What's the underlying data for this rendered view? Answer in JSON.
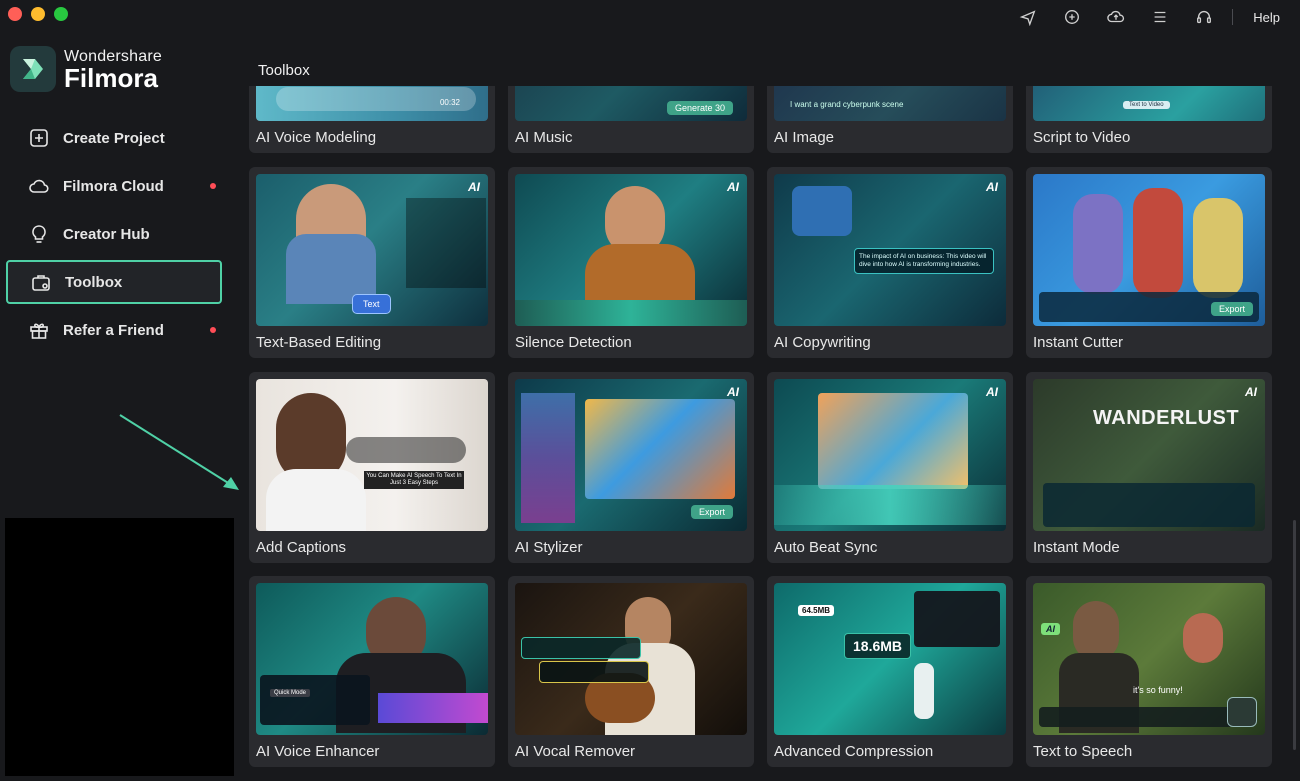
{
  "window": {
    "help_label": "Help"
  },
  "brand": {
    "line1": "Wondershare",
    "line2": "Filmora"
  },
  "nav": {
    "items": [
      {
        "label": "Create Project",
        "icon": "plus-square-icon",
        "dot": false,
        "active": false
      },
      {
        "label": "Filmora Cloud",
        "icon": "cloud-icon",
        "dot": true,
        "active": false
      },
      {
        "label": "Creator Hub",
        "icon": "lightbulb-icon",
        "dot": false,
        "active": false
      },
      {
        "label": "Toolbox",
        "icon": "toolbox-icon",
        "dot": false,
        "active": true
      },
      {
        "label": "Refer a Friend",
        "icon": "gift-icon",
        "dot": true,
        "active": false
      }
    ]
  },
  "main": {
    "title": "Toolbox"
  },
  "tools": [
    {
      "name": "AI Voice Modeling",
      "ai": false,
      "thumb_text": "00:32"
    },
    {
      "name": "AI Music",
      "ai": false,
      "thumb_text": "Generate 30"
    },
    {
      "name": "AI Image",
      "ai": false,
      "thumb_text": "I want a grand cyberpunk scene"
    },
    {
      "name": "Script to Video",
      "ai": false,
      "thumb_text": "Text to Video"
    },
    {
      "name": "Text-Based Editing",
      "ai": true,
      "thumb_text": "Text"
    },
    {
      "name": "Silence Detection",
      "ai": true,
      "thumb_text": ""
    },
    {
      "name": "AI Copywriting",
      "ai": true,
      "thumb_text": "The impact of AI on business: This video will dive into how AI is transforming industries."
    },
    {
      "name": "Instant Cutter",
      "ai": false,
      "thumb_text": "Export"
    },
    {
      "name": "Add Captions",
      "ai": false,
      "thumb_text": "You Can Make AI Speech To Text In Just 3 Easy Steps"
    },
    {
      "name": "AI Stylizer",
      "ai": true,
      "thumb_text": "Export"
    },
    {
      "name": "Auto Beat Sync",
      "ai": true,
      "thumb_text": ""
    },
    {
      "name": "Instant Mode",
      "ai": true,
      "thumb_text": "WANDERLUST"
    },
    {
      "name": "AI Voice Enhancer",
      "ai": false,
      "thumb_text": "Quick Mode"
    },
    {
      "name": "AI Vocal Remover",
      "ai": false,
      "thumb_text": ""
    },
    {
      "name": "Advanced Compression",
      "ai": false,
      "thumb_text": "18.6MB"
    },
    {
      "name": "Text to Speech",
      "ai": false,
      "thumb_text": "it's so funny!"
    }
  ],
  "colors": {
    "accent": "#4fd1a6",
    "dot": "#ff4d57",
    "background": "#18191c",
    "card": "#2a2b2f"
  }
}
